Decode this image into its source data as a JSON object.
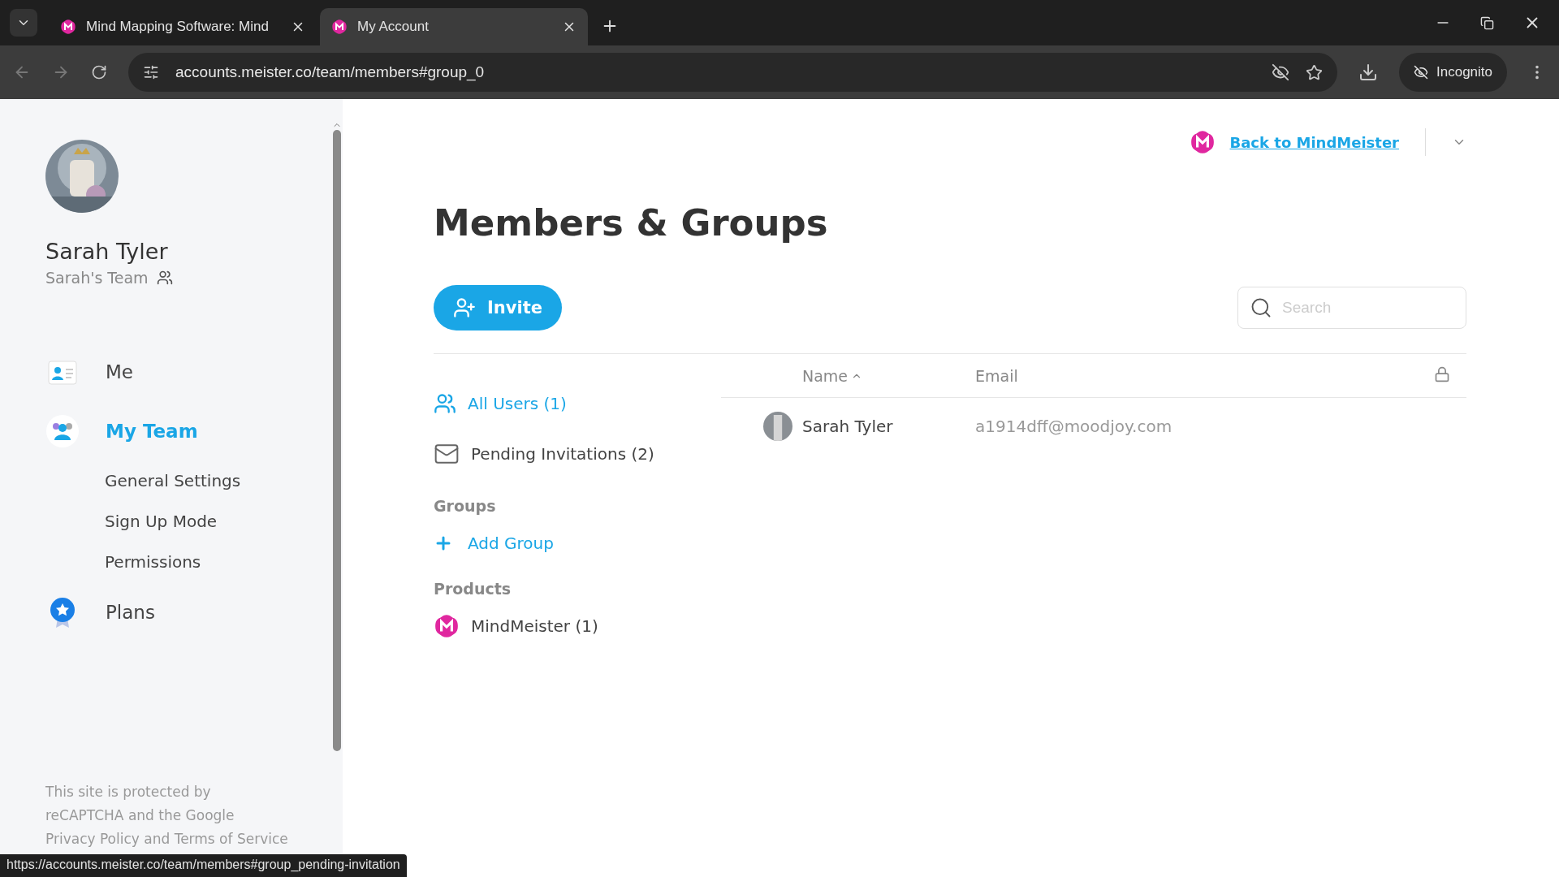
{
  "browser": {
    "tabs": [
      {
        "title": "Mind Mapping Software: Mind",
        "selected": false
      },
      {
        "title": "My Account",
        "selected": true
      }
    ],
    "url": "accounts.meister.co/team/members#group_0",
    "profile": "Incognito",
    "status_url": "https://accounts.meister.co/team/members#group_pending-invitation"
  },
  "sidebar": {
    "user_name": "Sarah Tyler",
    "team_name": "Sarah's Team",
    "items": [
      {
        "label": "Me",
        "kind": "main",
        "selected": false
      },
      {
        "label": "My Team",
        "kind": "main",
        "selected": true
      },
      {
        "label": "General Settings",
        "kind": "sub",
        "selected": false
      },
      {
        "label": "Sign Up Mode",
        "kind": "sub",
        "selected": false
      },
      {
        "label": "Permissions",
        "kind": "sub",
        "selected": false
      },
      {
        "label": "Plans",
        "kind": "main",
        "selected": false
      }
    ],
    "footer_lines": [
      "This site is protected by",
      "reCAPTCHA and the Google",
      "Privacy Policy and Terms of Service"
    ]
  },
  "header": {
    "back_link": "Back to MindMeister"
  },
  "page": {
    "title": "Members & Groups",
    "invite_button": "Invite",
    "search": {
      "placeholder": "Search"
    },
    "filters": [
      {
        "label": "All Users (1)",
        "selected": true
      },
      {
        "label": "Pending Invitations (2)",
        "selected": false
      }
    ],
    "groups_heading": "Groups",
    "add_group": "Add Group",
    "products_heading": "Products",
    "products": [
      {
        "label": "MindMeister (1)"
      }
    ],
    "table": {
      "columns": [
        {
          "label": "Name",
          "sorted": true
        },
        {
          "label": "Email",
          "sorted": false
        }
      ],
      "rows": [
        {
          "name": "Sarah Tyler",
          "email": "a1914dff@moodjoy.com"
        }
      ]
    }
  }
}
